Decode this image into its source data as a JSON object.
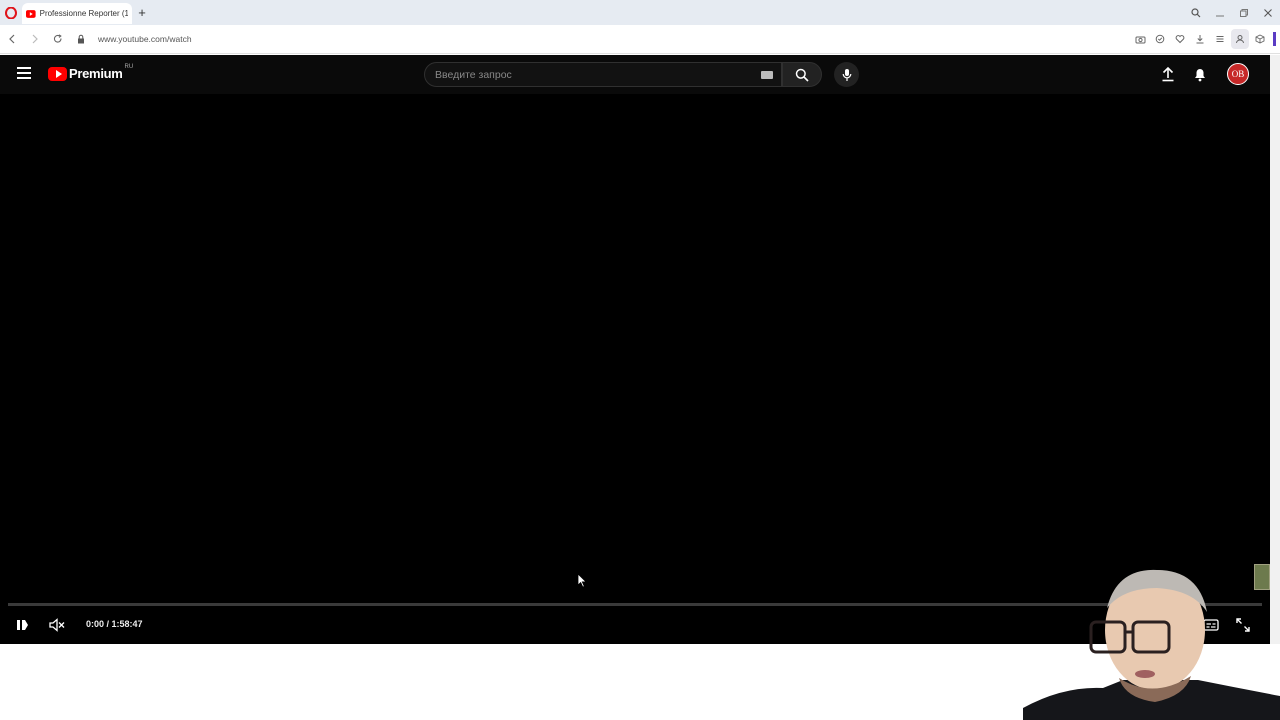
{
  "browser": {
    "tab_title": "Professionne Reporter (1’",
    "url": "www.youtube.com/watch",
    "new_tab_label": "+"
  },
  "youtube": {
    "logo_text": "Premium",
    "logo_region": "RU",
    "search_placeholder": "Введите запрос",
    "avatar_initials": "OB"
  },
  "player": {
    "time_display": "0:00 / 1:58:47",
    "progress_fraction": 0.0,
    "muted": true,
    "state": "paused"
  },
  "colors": {
    "brand_red": "#ff0000",
    "player_bg": "#000000",
    "opera_red": "#e0131a"
  }
}
